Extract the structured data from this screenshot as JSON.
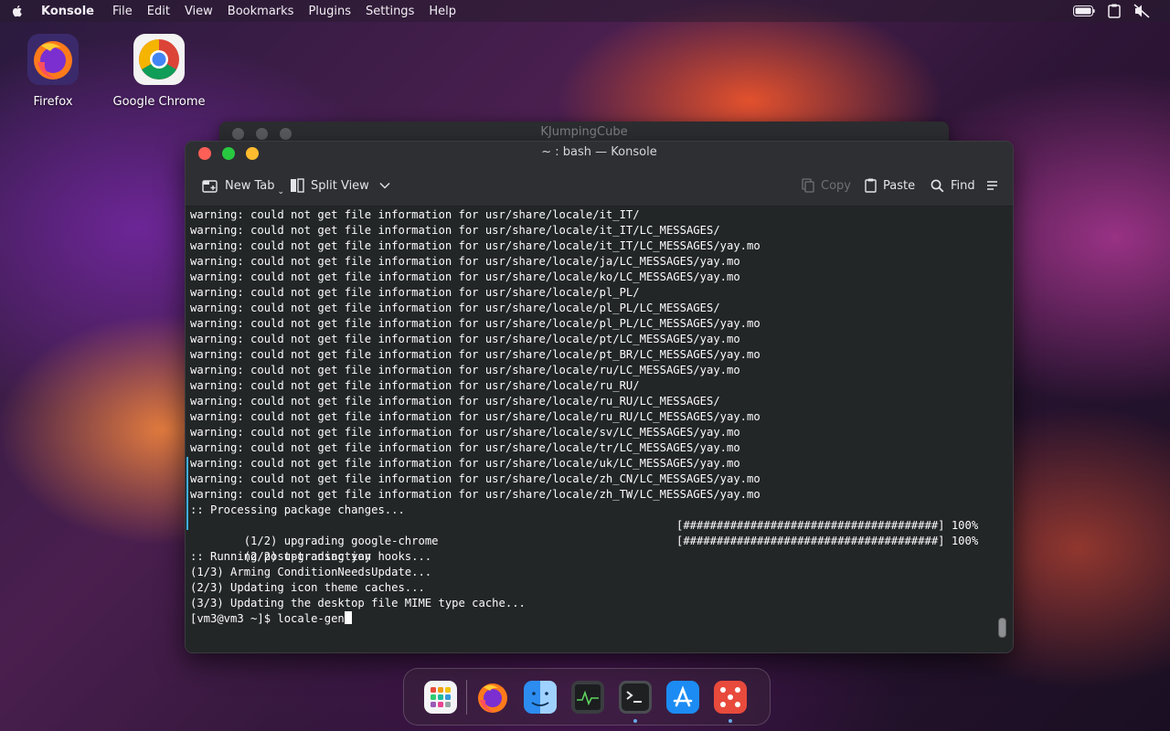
{
  "menubar": {
    "app_name": "Konsole",
    "menus": [
      "File",
      "Edit",
      "View",
      "Bookmarks",
      "Plugins",
      "Settings",
      "Help"
    ],
    "status_icons": [
      "battery-icon",
      "clipboard-icon",
      "speaker-muted-icon"
    ]
  },
  "desktop": {
    "icons": [
      {
        "label": "Firefox",
        "icon": "firefox-icon"
      },
      {
        "label": "Google Chrome",
        "icon": "chrome-icon"
      }
    ]
  },
  "background_window": {
    "title": "KJumpingCube"
  },
  "konsole": {
    "title": "~ : bash — Konsole",
    "toolbar": {
      "new_tab": "New Tab",
      "split_view": "Split View",
      "copy": "Copy",
      "paste": "Paste",
      "find": "Find"
    },
    "terminal": {
      "lines": [
        "warning: could not get file information for usr/share/locale/it_IT/",
        "warning: could not get file information for usr/share/locale/it_IT/LC_MESSAGES/",
        "warning: could not get file information for usr/share/locale/it_IT/LC_MESSAGES/yay.mo",
        "warning: could not get file information for usr/share/locale/ja/LC_MESSAGES/yay.mo",
        "warning: could not get file information for usr/share/locale/ko/LC_MESSAGES/yay.mo",
        "warning: could not get file information for usr/share/locale/pl_PL/",
        "warning: could not get file information for usr/share/locale/pl_PL/LC_MESSAGES/",
        "warning: could not get file information for usr/share/locale/pl_PL/LC_MESSAGES/yay.mo",
        "warning: could not get file information for usr/share/locale/pt/LC_MESSAGES/yay.mo",
        "warning: could not get file information for usr/share/locale/pt_BR/LC_MESSAGES/yay.mo",
        "warning: could not get file information for usr/share/locale/ru/LC_MESSAGES/yay.mo",
        "warning: could not get file information for usr/share/locale/ru_RU/",
        "warning: could not get file information for usr/share/locale/ru_RU/LC_MESSAGES/",
        "warning: could not get file information for usr/share/locale/ru_RU/LC_MESSAGES/yay.mo",
        "warning: could not get file information for usr/share/locale/sv/LC_MESSAGES/yay.mo",
        "warning: could not get file information for usr/share/locale/tr/LC_MESSAGES/yay.mo",
        "warning: could not get file information for usr/share/locale/uk/LC_MESSAGES/yay.mo",
        "warning: could not get file information for usr/share/locale/zh_CN/LC_MESSAGES/yay.mo",
        "warning: could not get file information for usr/share/locale/zh_TW/LC_MESSAGES/yay.mo",
        ":: Processing package changes...",
        "(1/2) upgrading google-chrome",
        "(2/2) upgrading yay",
        ":: Running post-transaction hooks...",
        "(1/3) Arming ConditionNeedsUpdate...",
        "(2/3) Updating icon theme caches...",
        "(3/3) Updating the desktop file MIME type cache..."
      ],
      "progress_1": "[######################################] 100%",
      "progress_2": "[######################################] 100%",
      "prompt": "[vm3@vm3 ~]$ locale-gen"
    }
  },
  "dock": {
    "items": [
      "app-grid-icon",
      "firefox-icon",
      "finder-icon",
      "system-monitor-icon",
      "terminal-icon",
      "app-store-icon",
      "dice-game-icon"
    ]
  },
  "colors": {
    "terminal_bg": "#232627",
    "terminal_fg": "#fcfcfc",
    "close": "#ff5f57",
    "minimize": "#febc2e",
    "maximize": "#28c840"
  }
}
